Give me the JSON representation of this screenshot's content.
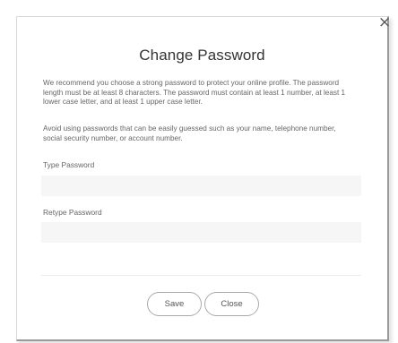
{
  "dialog": {
    "close_glyph": "×",
    "title": "Change Password",
    "recommendation_text": "We recommend you choose a strong password to protect your online profile. The password length must be at least 8 characters. The password must contain at least 1 number, at least 1 lower case letter, and at least 1 upper case letter.",
    "avoid_text": "Avoid using passwords that can be easily guessed such as your name, telephone number, social security number, or account number.",
    "type_password_label": "Type Password",
    "type_password_value": "",
    "retype_password_label": "Retype Password",
    "retype_password_value": "",
    "save_label": "Save",
    "close_label": "Close"
  }
}
